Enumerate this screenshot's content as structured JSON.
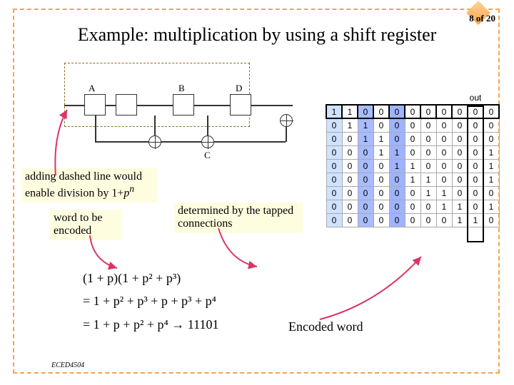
{
  "page": {
    "current": 8,
    "total": 20,
    "label": "8 of 20"
  },
  "title": "Example: multiplication by using a shift register",
  "shift_register": {
    "labels": {
      "A": "A",
      "B": "B",
      "C": "C",
      "D": "D",
      "out": "out"
    }
  },
  "callouts": {
    "dashed": "adding dashed line would enable division by 1+pⁿ",
    "word": "word to be encoded",
    "tapped": "determined by the tapped connections",
    "encoded": "Encoded word"
  },
  "equations": {
    "line1": "(1 + p)(1 + p² + p³)",
    "line2": "= 1 + p² + p³ + p + p³ + p⁴",
    "line3": "= 1 + p + p² + p⁴ → 11101"
  },
  "table": {
    "out_header": "out",
    "rows": [
      [
        1,
        1,
        0,
        0,
        0,
        0,
        0,
        0,
        0,
        0,
        0
      ],
      [
        0,
        1,
        1,
        0,
        0,
        0,
        0,
        0,
        0,
        0,
        0
      ],
      [
        0,
        0,
        1,
        1,
        0,
        0,
        0,
        0,
        0,
        0,
        0
      ],
      [
        0,
        0,
        0,
        1,
        1,
        0,
        0,
        0,
        0,
        0,
        1
      ],
      [
        0,
        0,
        0,
        0,
        1,
        1,
        0,
        0,
        0,
        0,
        1
      ],
      [
        0,
        0,
        0,
        0,
        0,
        1,
        1,
        0,
        0,
        0,
        1
      ],
      [
        0,
        0,
        0,
        0,
        0,
        0,
        1,
        1,
        0,
        0,
        0
      ],
      [
        0,
        0,
        0,
        0,
        0,
        0,
        0,
        1,
        1,
        0,
        1
      ],
      [
        0,
        0,
        0,
        0,
        0,
        0,
        0,
        0,
        1,
        1,
        0
      ]
    ],
    "highlight_cols": {
      "a": 0,
      "b": 2,
      "d": 4
    }
  },
  "course_code": "ECED4504"
}
